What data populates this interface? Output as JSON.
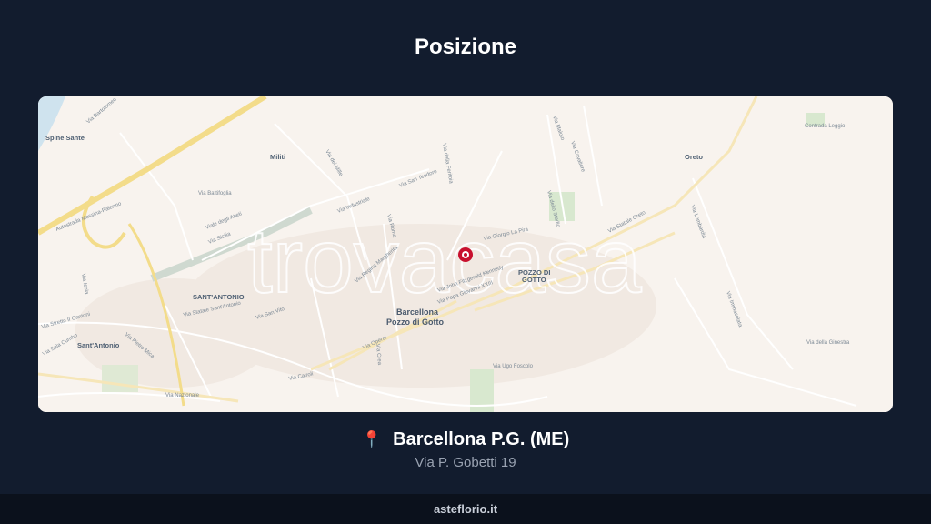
{
  "page": {
    "title": "Posizione"
  },
  "map": {
    "watermark": "trovacasa",
    "place_labels": {
      "spine_sante": "Spine Sante",
      "militi": "Militi",
      "oreto": "Oreto",
      "santantonio_upper": "SANT'ANTONIO",
      "santantonio": "Sant'Antonio",
      "barcellona_line1": "Barcellona",
      "barcellona_line2": "Pozzo di Gotto",
      "pozzo_line1": "POZZO DI",
      "pozzo_line2": "GOTTO"
    },
    "street_labels": {
      "autostrada": "Autostrada Messina-Palermo",
      "via_statale_oreto": "Via Statale Oreto",
      "via_operai": "Via Operai",
      "via_nazionale": "Via Nazionale",
      "via_papa_giovanni": "Via Papa Giovanni XXIII",
      "via_kennedy": "Via John Fitzgerald Kennedy",
      "via_giorgio_la_pira": "Via Giorgio La Pira",
      "via_san_vito": "Via San Vito",
      "via_della_ginestra": "Via della Ginestra",
      "via_ugo_foscolo": "Via Ugo Foscolo",
      "via_statale_santantonio": "Via Statale Sant'Antonio",
      "via_san_teodoro": "Via San Teodoro",
      "via_industriale": "Via Industriale",
      "via_dei_mille": "Via dei Mille",
      "via_sicilia": "Via Sicilia",
      "via_cairoli": "Via Cairoli",
      "viale_degli_atleti": "Viale degli Atleti",
      "via_maloto": "Via Maloto",
      "contrada_leggio": "Contrada Leggio",
      "via_stretto": "Via Stretto II Cantoni",
      "via_pietro_mica": "Via Pietro Mica",
      "via_sala_cumbo": "Via Sala Cumbo",
      "via_bartolomeo": "Via Bartolomeo",
      "via_isola": "Via Isola",
      "via_battifoglia": "Via Battifoglia",
      "via_lombardia": "Via Lombardia",
      "via_roma": "Via Roma",
      "via_dello_stadio": "Via dello Stadio",
      "via_cavaliere": "Via Cavaliere",
      "via_della_feritoia": "Via della Feritoia",
      "via_immacolata": "Via Immacolata",
      "via_crea": "Via Crea",
      "via_regina_margherita": "Via Regina Margherita"
    },
    "colors": {
      "marker": "#c8102e",
      "background": "#f8f3ee",
      "motorway": "#f3dc8a",
      "water": "#cfe3ee",
      "green": "#d8e8cf"
    }
  },
  "location": {
    "city": "Barcellona P.G. (ME)",
    "address": "Via P. Gobetti 19",
    "pin_icon": "📍"
  },
  "footer": {
    "site": "asteflorio.it"
  }
}
